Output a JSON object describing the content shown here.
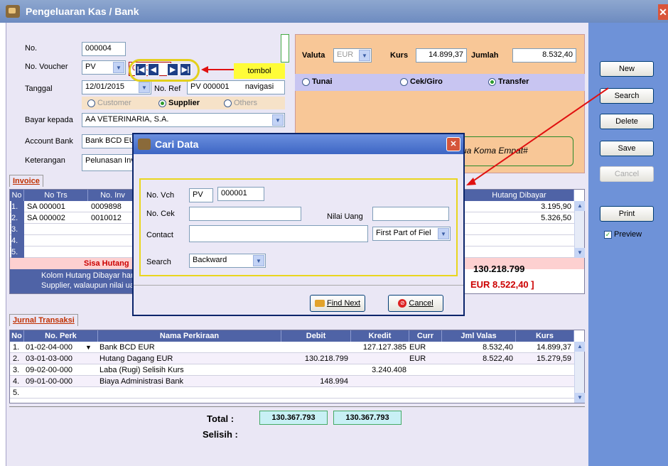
{
  "window": {
    "title": "Pengeluaran Kas / Bank",
    "close": "✕"
  },
  "header": {
    "no_label": "No.",
    "no_value": "000004",
    "voucher_label": "No. Voucher",
    "voucher_type": "PV",
    "voucher_number": "000001",
    "tanggal_label": "Tanggal",
    "tanggal_value": "12/01/2015",
    "noref_label": "No. Ref",
    "noref_value": "PV 000001",
    "customer_label": "Customer",
    "supplier_label": "Supplier",
    "others_label": "Others",
    "bayar_label": "Bayar kepada",
    "bayar_value": "AA VETERINARIA, S.A.",
    "account_label": "Account Bank",
    "account_value": "Bank BCD EU",
    "keterangan_label": "Keterangan",
    "keterangan_value": "Pelunasan Inv",
    "callout": "tombol navigasi"
  },
  "nav": {
    "first": "|◀",
    "prev": "◀",
    "next": "▶",
    "last": "▶|"
  },
  "currency": {
    "valuta_label": "Valuta",
    "valuta_value": "EUR",
    "kurs_label": "Kurs",
    "kurs_value": "14.899,37",
    "jumlah_label": "Jumlah",
    "jumlah_value": "8.532,40",
    "tunai": "Tunai",
    "cekgiro": "Cek/Giro",
    "transfer": "Transfer",
    "terbilang_tail": "ua Koma Empat#"
  },
  "invoice": {
    "tab": "Invoice",
    "headers": [
      "No",
      "No Trs",
      "No. Inv"
    ],
    "hutang_header": "Hutang Dibayar",
    "rows": [
      {
        "no": "1.",
        "trs": "SA 000001",
        "inv": "0009898",
        "hutang": "3.195,90"
      },
      {
        "no": "2.",
        "trs": "SA 000002",
        "inv": "0010012",
        "hutang": "5.326,50"
      },
      {
        "no": "3.",
        "trs": "",
        "inv": "",
        "hutang": ""
      },
      {
        "no": "4.",
        "trs": "",
        "inv": "",
        "hutang": ""
      },
      {
        "no": "5.",
        "trs": "",
        "inv": "",
        "hutang": ""
      }
    ],
    "sisa_label": "Sisa Hutang",
    "note1": "Kolom Hutang Dibayar har",
    "note2": "Supplier, walaupun nilai ua",
    "total1": "130.218.799",
    "total2": "EUR 8.522,40 ]"
  },
  "jurnal": {
    "tab": "Jurnal Transaksi",
    "headers": [
      "No",
      "No. Perk",
      "Nama Perkiraan",
      "Debit",
      "Kredit",
      "Curr",
      "Jml Valas",
      "Kurs"
    ],
    "rows": [
      {
        "no": "1.",
        "perk": "01-02-04-000",
        "nama": "Bank BCD EUR",
        "debit": "",
        "kredit": "127.127.385",
        "curr": "EUR",
        "valas": "8.532,40",
        "kurs": "14.899,37"
      },
      {
        "no": "2.",
        "perk": "03-01-03-000",
        "nama": "Hutang Dagang EUR",
        "debit": "130.218.799",
        "kredit": "",
        "curr": "EUR",
        "valas": "8.522,40",
        "kurs": "15.279,59"
      },
      {
        "no": "3.",
        "perk": "09-02-00-000",
        "nama": "Laba (Rugi) Selisih Kurs",
        "debit": "",
        "kredit": "3.240.408",
        "curr": "",
        "valas": "",
        "kurs": ""
      },
      {
        "no": "4.",
        "perk": "09-01-00-000",
        "nama": "Biaya Administrasi Bank",
        "debit": "148.994",
        "kredit": "",
        "curr": "",
        "valas": "",
        "kurs": ""
      },
      {
        "no": "5.",
        "perk": "",
        "nama": "",
        "debit": "",
        "kredit": "",
        "curr": "",
        "valas": "",
        "kurs": ""
      }
    ],
    "total_label": "Total :",
    "total_debit": "130.367.793",
    "total_kredit": "130.367.793",
    "selisih_label": "Selisih :"
  },
  "sidebar": {
    "new": "New",
    "search": "Search",
    "delete": "Delete",
    "save": "Save",
    "cancel": "Cancel",
    "print": "Print",
    "preview": "Preview"
  },
  "dialog": {
    "title": "Cari Data",
    "close": "✕",
    "novch_label": "No. Vch",
    "novch_type": "PV",
    "novch_value": "000001",
    "nocek_label": "No. Cek",
    "nilai_label": "Nilai Uang",
    "contact_label": "Contact",
    "contact_mode": "First Part of Fiel",
    "search_label": "Search",
    "search_value": "Backward",
    "find_next": "Find Next",
    "cancel": "Cancel"
  }
}
